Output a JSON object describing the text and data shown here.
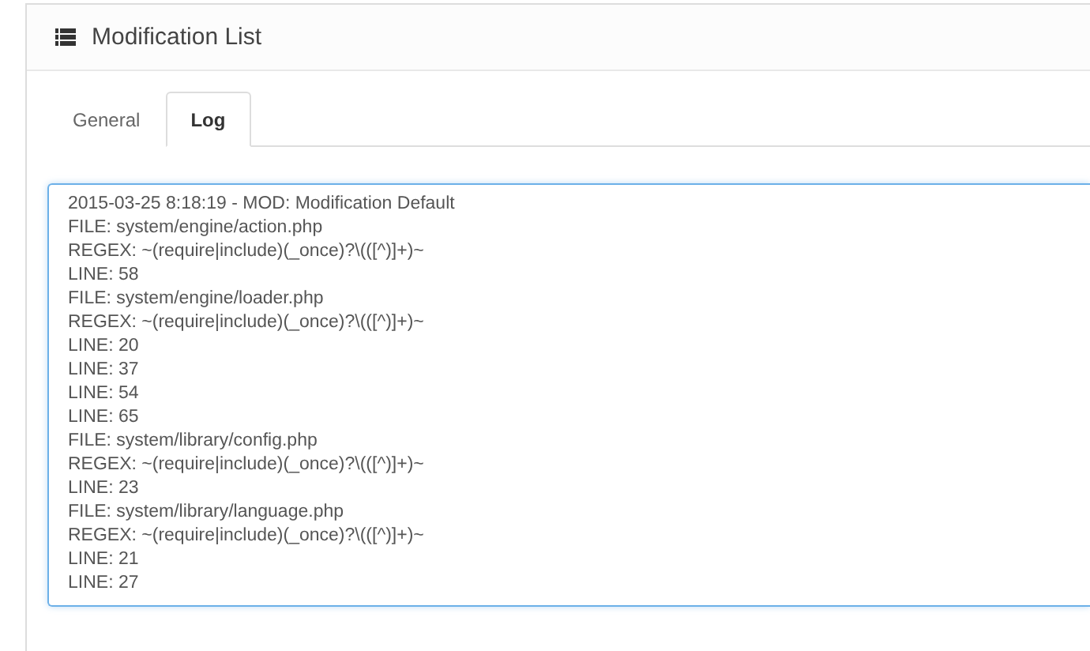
{
  "panel": {
    "title": "Modification List"
  },
  "tabs": [
    {
      "label": "General",
      "selected": false
    },
    {
      "label": "Log",
      "selected": true
    }
  ],
  "log": {
    "lines": [
      "2015-03-25 8:18:19 - MOD: Modification Default",
      "FILE: system/engine/action.php",
      "REGEX: ~(require|include)(_once)?\\(([^)]+)~",
      "LINE: 58",
      "FILE: system/engine/loader.php",
      "REGEX: ~(require|include)(_once)?\\(([^)]+)~",
      "LINE: 20",
      "LINE: 37",
      "LINE: 54",
      "LINE: 65",
      "FILE: system/library/config.php",
      "REGEX: ~(require|include)(_once)?\\(([^)]+)~",
      "LINE: 23",
      "FILE: system/library/language.php",
      "REGEX: ~(require|include)(_once)?\\(([^)]+)~",
      "LINE: 21",
      "LINE: 27"
    ]
  }
}
